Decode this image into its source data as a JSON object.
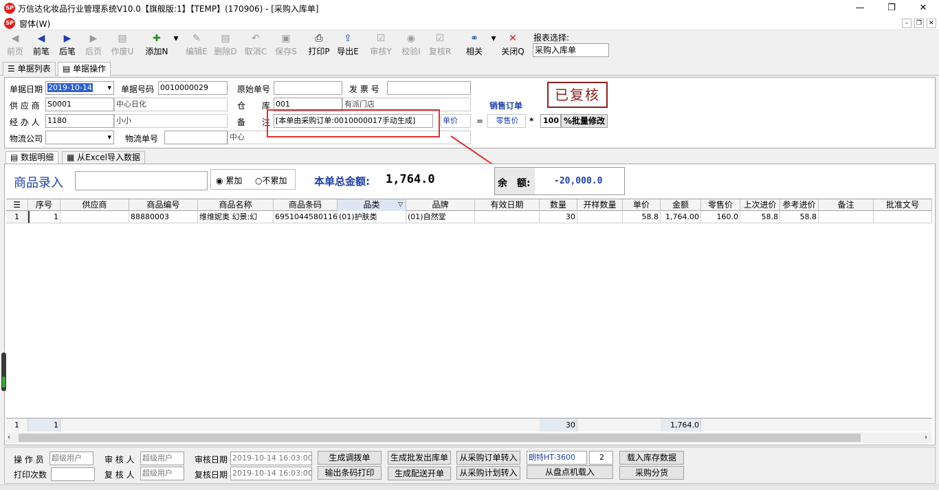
{
  "window": {
    "title": "万信达化妆品行业管理系统V10.0【旗舰版:1】【TEMP】(170906) - [采购入库单]",
    "logo_text": "SP",
    "menu": "窗体(W)",
    "min": "—",
    "max": "❐",
    "close": "✕"
  },
  "toolbar": {
    "items": [
      {
        "label": "前页",
        "icon": "◀"
      },
      {
        "label": "前笔",
        "icon": "◀"
      },
      {
        "label": "后笔",
        "icon": "▶"
      },
      {
        "label": "后页",
        "icon": "▶"
      },
      {
        "label": "作废U",
        "icon": "▤"
      },
      {
        "label": "添加N",
        "icon": "✚"
      },
      {
        "label": "编辑E",
        "icon": "✎"
      },
      {
        "label": "删除D",
        "icon": "▤"
      },
      {
        "label": "取消C",
        "icon": "↶"
      },
      {
        "label": "保存S",
        "icon": "▣"
      },
      {
        "label": "打印P",
        "icon": "⎙"
      },
      {
        "label": "导出E",
        "icon": "⇪"
      },
      {
        "label": "审核Y",
        "icon": "☑"
      },
      {
        "label": "校验I",
        "icon": "◉"
      },
      {
        "label": "复核R",
        "icon": "☑"
      },
      {
        "label": "相关",
        "icon": "⚭"
      },
      {
        "label": "关闭Q",
        "icon": "✕"
      }
    ],
    "report_label": "报表选择:",
    "report_value": "采购入库单",
    "dropdown_arrow": "▾"
  },
  "tabs": [
    {
      "label": "单据列表",
      "icon": "☰"
    },
    {
      "label": "单据操作",
      "icon": "▤"
    }
  ],
  "form": {
    "date_label": "单据日期",
    "date_value": "2019-10-14",
    "docno_label": "单据号码",
    "docno_value": "0010000029",
    "orig_label": "原始单号",
    "orig_value": "",
    "invoice_label": "发 票 号",
    "invoice_value": "",
    "supplier_label": "供 应 商",
    "supplier_code": "S0001",
    "supplier_name": "中心日化",
    "warehouse_label": "仓　　库",
    "warehouse_code": "001",
    "warehouse_name": "有派门店",
    "sales_order": "销售订单",
    "handler_label": "经 办 人",
    "handler_code": "1180",
    "handler_name": "小小",
    "remark_label": "备　　注",
    "remark_value": "[本单由采购订单:0010000017手动生成]",
    "price_label": "单价",
    "equals": "=",
    "retail_label": "零售价",
    "times": "*",
    "percent": "100",
    "batch_btn": "%批量修改",
    "logistics_label": "物流公司",
    "logistics_value": "",
    "logistics_no_label": "物流单号",
    "logistics_no_value": "",
    "center": "中心",
    "stamp": "已复核",
    "chevron": "▾"
  },
  "subtabs": [
    {
      "label": "数据明细",
      "icon": "▤"
    },
    {
      "label": "从Excel导入数据",
      "icon": "▦"
    }
  ],
  "entry": {
    "label": "商品录入",
    "value": "",
    "radio1": "累加",
    "radio2": "不累加",
    "total_label": "本单总金额:",
    "total_value": "1,764.0",
    "balance_label": "余　额:",
    "balance_value": "-20,000.0"
  },
  "grid": {
    "headers": [
      "序号",
      "供应商",
      "商品编号",
      "商品名称",
      "商品条码",
      "品类",
      "品牌",
      "有效日期",
      "数量",
      "开样数量",
      "单价",
      "金额",
      "零售价",
      "上次进价",
      "参考进价",
      "备注",
      "批准文号"
    ],
    "row": {
      "rownum": "1",
      "cells": [
        "1",
        "",
        "88880003",
        "维维妮奥 幻景:幻",
        "6951044580116",
        "(01)护肤类",
        "(01)自然堂",
        "",
        "30",
        "",
        "58.8",
        "1,764.00",
        "160.0",
        "58.8",
        "58.8",
        "",
        ""
      ]
    },
    "footer": {
      "rownum": "1",
      "seq": "1",
      "qty": "30",
      "amount": "1,764.0"
    }
  },
  "bottom": {
    "operator_label": "操 作 员",
    "operator_value": "超级用户",
    "auditor_label": "审 核 人",
    "auditor_value": "超级用户",
    "audit_date_label": "审核日期",
    "audit_date_value": "2019-10-14 16:03:00",
    "print_count_label": "打印次数",
    "print_count_value": "",
    "reviewer_label": "复 核 人",
    "reviewer_value": "超级用户",
    "review_date_label": "复核日期",
    "review_date_value": "2019-10-14 16:03:00",
    "btn_transfer": "生成调拨单",
    "btn_wholesale": "生成批发出库单",
    "btn_from_po": "从采购订单转入",
    "device": "朗特HT-3600",
    "device_num": "2",
    "btn_load_stock": "载入库存数据",
    "btn_barcode": "输出条码打印",
    "btn_delivery": "生成配送开单",
    "btn_from_plan": "从采购计划转入",
    "btn_from_counter": "从盘点机载入",
    "btn_distribute": "采购分货"
  },
  "colors": {
    "accent": "#1f3fa8",
    "stamp": "#8a2020",
    "highlight": "#e03030"
  }
}
